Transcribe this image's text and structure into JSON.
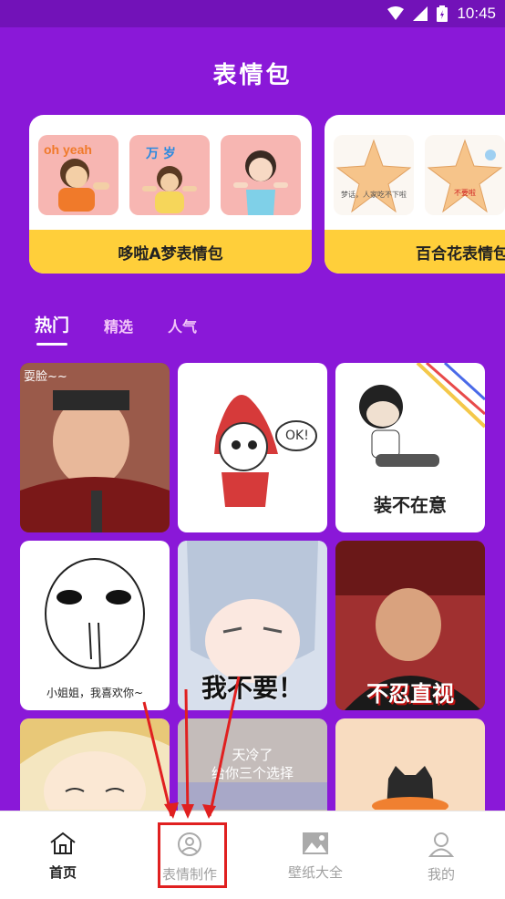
{
  "status_bar": {
    "time": "10:45"
  },
  "app": {
    "title": "表情包"
  },
  "collections": [
    {
      "title": "哆啦A梦表情包",
      "stickers": [
        "oh yeah",
        "万 岁",
        ""
      ]
    },
    {
      "title": "百合花表情包",
      "stickers": [
        "梦话，人家吃不下啦",
        "不要啦"
      ]
    }
  ],
  "tabs": [
    {
      "label": "热门",
      "active": true
    },
    {
      "label": "精选",
      "active": false
    },
    {
      "label": "人气",
      "active": false
    }
  ],
  "grid": [
    {
      "caption": "",
      "overlay": "耍脸~~"
    },
    {
      "caption": "",
      "bubble": "OK!"
    },
    {
      "caption": "装不在意"
    },
    {
      "caption": "小姐姐，我喜欢你~"
    },
    {
      "caption": "我不要！"
    },
    {
      "caption": "不忍直视"
    },
    {
      "caption": ""
    },
    {
      "caption": "天冷了\n给你三个选择"
    },
    {
      "caption": ""
    }
  ],
  "nav": [
    {
      "label": "首页",
      "icon": "home-icon",
      "active": true
    },
    {
      "label": "表情制作",
      "icon": "user-circle-icon",
      "active": false
    },
    {
      "label": "壁纸大全",
      "icon": "image-icon",
      "active": false
    },
    {
      "label": "我的",
      "icon": "person-icon",
      "active": false
    }
  ],
  "colors": {
    "background": "#8a18d8",
    "status_bar": "#7212b8",
    "accent_yellow": "#ffcf3a",
    "annotation_red": "#e02020"
  }
}
